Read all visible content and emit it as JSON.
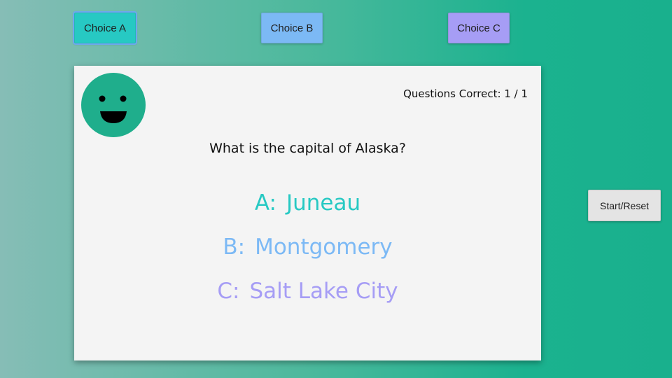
{
  "choices": {
    "a_label": "Choice A",
    "b_label": "Choice B",
    "c_label": "Choice C"
  },
  "card": {
    "score_text": "Questions Correct: 1 / 1",
    "question": "What is the capital of Alaska?",
    "answers": [
      {
        "letter": "A:",
        "text": "Juneau"
      },
      {
        "letter": "B:",
        "text": "Montgomery"
      },
      {
        "letter": "C:",
        "text": "Salt Lake City"
      }
    ],
    "face_icon": "smiley-face-icon"
  },
  "controls": {
    "start_reset_label": "Start/Reset"
  },
  "colors": {
    "choice_a": "#27c9c3",
    "choice_b": "#7cb9f5",
    "choice_c": "#a69df5",
    "smiley": "#1fae8c",
    "background_end": "#19b08d"
  }
}
